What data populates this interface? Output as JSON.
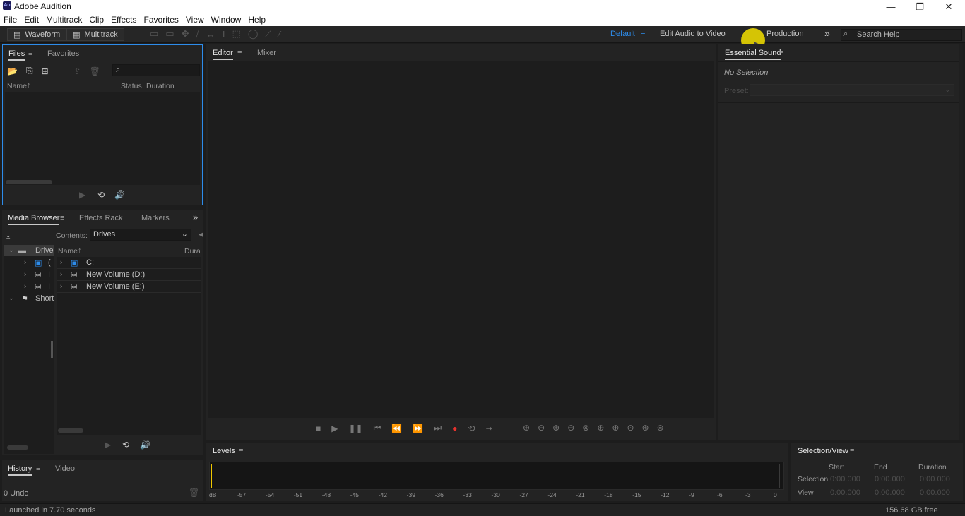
{
  "window": {
    "app_badge": "Au",
    "title": "Adobe Audition",
    "minimize": "—",
    "restore": "❐",
    "close": "✕"
  },
  "menu": [
    "File",
    "Edit",
    "Multitrack",
    "Clip",
    "Effects",
    "Favorites",
    "View",
    "Window",
    "Help"
  ],
  "toolbar": {
    "waveform": "Waveform",
    "multitrack": "Multitrack",
    "workspaces": {
      "default": "Default",
      "edit_audio_to_video": "Edit Audio to Video",
      "production": "Production"
    },
    "overflow": "»",
    "search_placeholder": "Search Help"
  },
  "files_panel": {
    "tabs": [
      "Files",
      "Favorites"
    ],
    "columns": {
      "name": "Name",
      "status": "Status",
      "duration": "Duration"
    }
  },
  "media_browser": {
    "tabs": [
      "Media Browser",
      "Effects Rack",
      "Markers"
    ],
    "contents_label": "Contents:",
    "contents_value": "Drives",
    "tree": [
      {
        "label": "Drive"
      },
      {
        "label": "("
      },
      {
        "label": "I"
      },
      {
        "label": "I"
      },
      {
        "label": "Short"
      }
    ],
    "columns": {
      "name": "Name",
      "duration": "Dura"
    },
    "items": [
      "C:",
      "New Volume (D:)",
      "New Volume (E:)"
    ]
  },
  "history_panel": {
    "tabs": [
      "History",
      "Video"
    ],
    "undo_count": "0 Undo"
  },
  "editor": {
    "tabs": [
      "Editor",
      "Mixer"
    ]
  },
  "essential_sound": {
    "title": "Essential Sound",
    "no_selection": "No Selection",
    "preset_label": "Preset:"
  },
  "levels": {
    "title": "Levels",
    "ticks": [
      "dB",
      "-57",
      "-54",
      "-51",
      "-48",
      "-45",
      "-42",
      "-39",
      "-36",
      "-33",
      "-30",
      "-27",
      "-24",
      "-21",
      "-18",
      "-15",
      "-12",
      "-9",
      "-6",
      "-3",
      "0"
    ]
  },
  "selection_view": {
    "title": "Selection/View",
    "columns": [
      "Start",
      "End",
      "Duration"
    ],
    "rows": [
      {
        "label": "Selection",
        "start": "0:00.000",
        "end": "0:00.000",
        "duration": "0:00.000"
      },
      {
        "label": "View",
        "start": "0:00.000",
        "end": "0:00.000",
        "duration": "0:00.000"
      }
    ]
  },
  "status": {
    "launched": "Launched in 7.70 seconds",
    "free_space": "156.68 GB free"
  },
  "colors": {
    "accent": "#2d8ceb",
    "record": "#e8322d",
    "cursor_highlight": "#f5e000",
    "panel": "#232323",
    "background": "#1d1d1d"
  }
}
